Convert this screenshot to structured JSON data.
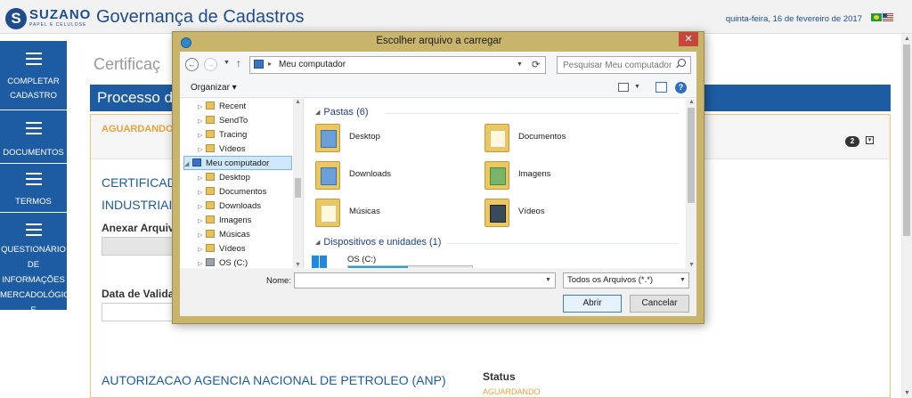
{
  "header": {
    "logo_mark": "S",
    "logo_name": "SUZANO",
    "logo_sub": "PAPEL E CELULOSE",
    "app_title": "Governança de Cadastros",
    "date": "quinta-feira, 16 de fevereiro de 2017",
    "flags": [
      "flag-br-icon",
      "flag-us-icon"
    ]
  },
  "sidebar": {
    "items": [
      {
        "label": "COMPLETAR CADASTRO",
        "icon": "menu-icon"
      },
      {
        "label": "DOCUMENTOS",
        "icon": "menu-icon"
      },
      {
        "label": "TERMOS",
        "icon": "menu-icon"
      },
      {
        "label": "QUESTIONÁRIO DE INFORMAÇÕES MERCADOLÓGICAS E ESTRUTURAIS",
        "icon": "menu-icon"
      }
    ]
  },
  "main": {
    "heading": "Certificaç",
    "process_bar": "Processo de",
    "panel": {
      "status_head": "AGUARDANDO",
      "count": "2",
      "collapse": "▾",
      "cert_title": "CERTIFICADO INDUSTRIAIS",
      "attach_label": "Anexar Arquiv",
      "date_label": "Data de Valida",
      "anp_title": "AUTORIZACAO AGENCIA NACIONAL DE PETROLEO (ANP)",
      "status_label": "Status",
      "status_value": "AGUARDANDO"
    }
  },
  "dialog": {
    "title": "Escolher arquivo a carregar",
    "close": "✕",
    "address": "Meu computador",
    "search_placeholder": "Pesquisar Meu computador",
    "organize": "Organizar ▾",
    "nav_tree": [
      {
        "label": "Recent",
        "icon": "folder-icon"
      },
      {
        "label": "SendTo",
        "icon": "folder-icon"
      },
      {
        "label": "Tracing",
        "icon": "folder-icon"
      },
      {
        "label": "Vídeos",
        "icon": "folder-icon"
      },
      {
        "label": "Meu computador",
        "icon": "computer-icon",
        "selected": true
      },
      {
        "label": "Desktop",
        "icon": "folder-icon"
      },
      {
        "label": "Documentos",
        "icon": "folder-icon"
      },
      {
        "label": "Downloads",
        "icon": "folder-icon"
      },
      {
        "label": "Imagens",
        "icon": "folder-icon"
      },
      {
        "label": "Músicas",
        "icon": "folder-icon"
      },
      {
        "label": "Vídeos",
        "icon": "folder-icon"
      },
      {
        "label": "OS (C:)",
        "icon": "drive-icon"
      }
    ],
    "folders_group": "Pastas (6)",
    "folders": [
      "Desktop",
      "Documentos",
      "Downloads",
      "Imagens",
      "Músicas",
      "Vídeos"
    ],
    "devices_group": "Dispositivos e unidades (1)",
    "drive": {
      "label": "OS (C:)",
      "used_fraction": 0.48
    },
    "name_label": "Nome:",
    "name_value": "",
    "file_type": "Todos os Arquivos (*.*)",
    "open_button": "Abrir",
    "cancel_button": "Cancelar"
  }
}
